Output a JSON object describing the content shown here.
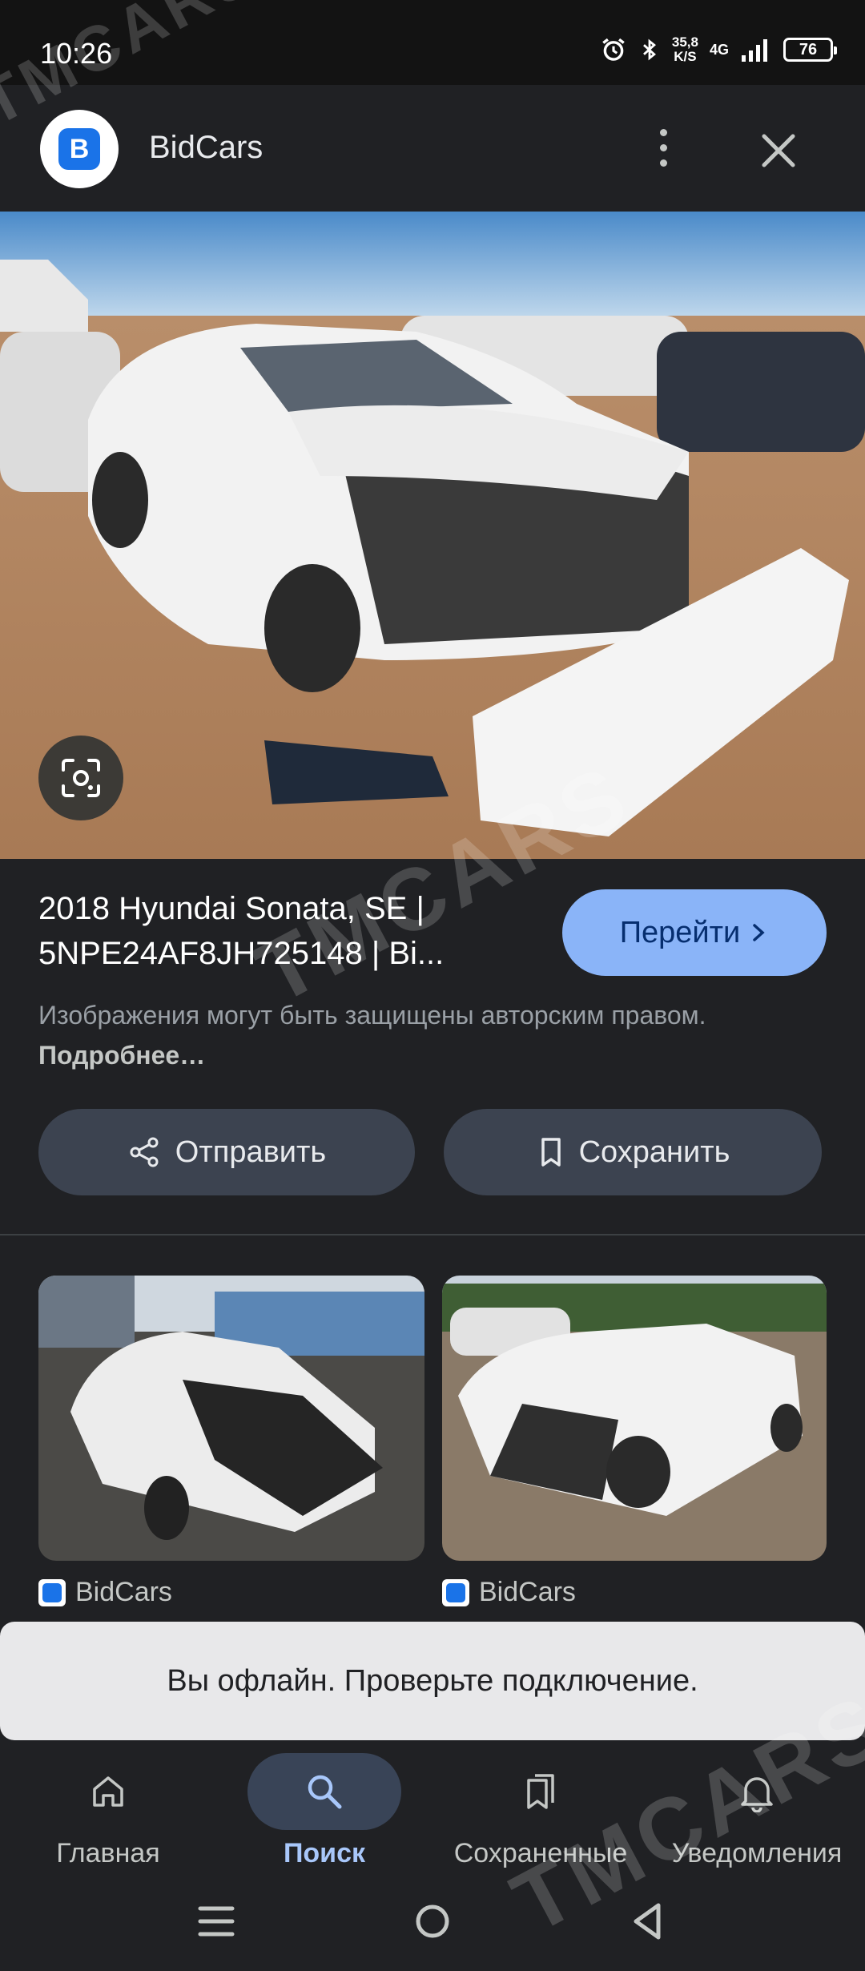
{
  "status_bar": {
    "time": "10:26",
    "speed_value": "35,8",
    "speed_unit": "K/S",
    "network": "4G",
    "battery": "76"
  },
  "header": {
    "app_name": "BidCars"
  },
  "result": {
    "title": "2018 Hyundai Sonata, SE | 5NPE24AF8JH725148 | Bi...",
    "goto_label": "Перейти",
    "copyright_text": "Изображения могут быть защищены авторским правом.",
    "more_link": "Подробнее…"
  },
  "actions": {
    "share_label": "Отправить",
    "save_label": "Сохранить"
  },
  "related": [
    {
      "source": "BidCars"
    },
    {
      "source": "BidCars"
    }
  ],
  "toast": {
    "message": "Вы офлайн. Проверьте подключение."
  },
  "bottom_nav": {
    "items": [
      {
        "label": "Главная",
        "icon": "home-icon"
      },
      {
        "label": "Поиск",
        "icon": "search-icon",
        "active": true
      },
      {
        "label": "Сохраненные",
        "icon": "saved-icon"
      },
      {
        "label": "Уведомления",
        "icon": "bell-icon"
      }
    ]
  },
  "watermark": "TMCARS",
  "colors": {
    "accent": "#8ab4f8",
    "background": "#202124",
    "action_button": "#3c4350",
    "toast": "#e8e8ea"
  }
}
